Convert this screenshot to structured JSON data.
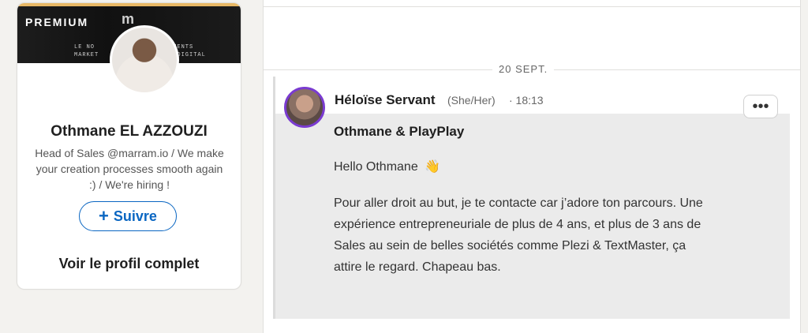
{
  "profile_card": {
    "banner_label": "PREMIUM",
    "banner_logo": "m",
    "banner_line1": "LE NO",
    "banner_line2": "MARKET",
    "banner_line3": "EMENTS",
    "banner_line4": "T DIGITAL",
    "name": "Othmane EL AZZOUZI",
    "headline": "Head of Sales @marram.io / We make your creation processes smooth again :) / We're hiring !",
    "follow_label": "Suivre",
    "follow_icon": "plus-icon",
    "view_profile_label": "Voir le profil complet"
  },
  "conversation": {
    "date_label": "20 SEPT.",
    "sender_name": "Héloïse Servant",
    "pronouns": "(She/Her)",
    "time": "· 18:13",
    "more_icon": "more-horizontal-icon",
    "subject": "Othmane & PlayPlay",
    "greeting": "Hello Othmane",
    "greeting_emoji": "👋",
    "body": "Pour aller droit au but, je te contacte car j’adore ton parcours. Une expérience entrepreneuriale de plus de 4 ans, et plus de 3 ans de Sales au sein de belles sociétés comme Plezi & TextMaster, ça attire le regard. Chapeau bas."
  },
  "colors": {
    "accent": "#0a66c2",
    "premium_gold": "#e8b865",
    "open_to_work_ring": "#7a3bd0"
  }
}
